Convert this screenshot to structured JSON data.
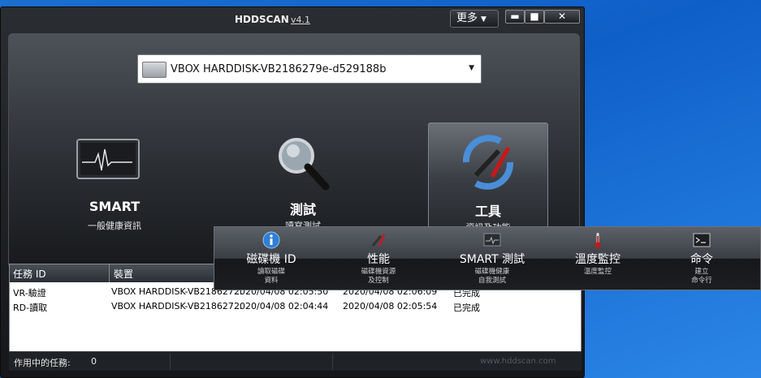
{
  "window": {
    "title": "HDDSCAN",
    "version": "v4.1",
    "more_label": "更多",
    "min_label": "▬",
    "max_label": "■",
    "close_label": "✕"
  },
  "drive": {
    "selected": "VBOX HARDDISK-VB2186279e-d529188b"
  },
  "tiles": [
    {
      "label": "SMART",
      "sub": "一般健康資訊",
      "icon": "monitor-icon"
    },
    {
      "label": "測試",
      "sub": "讀寫測試",
      "icon": "magnifier-icon"
    },
    {
      "label": "工具",
      "sub": "資訊及功能",
      "icon": "tools-icon"
    }
  ],
  "tools_menu": [
    {
      "label": "磁碟機 ID",
      "sub1": "讀取磁碟",
      "sub2": "資料",
      "icon": "info-icon"
    },
    {
      "label": "性能",
      "sub1": "磁碟機資源",
      "sub2": "及控制",
      "icon": "hammer-icon"
    },
    {
      "label": "SMART 測試",
      "sub1": "磁碟機健康",
      "sub2": "自我測試",
      "icon": "pulse-icon"
    },
    {
      "label": "溫度監控",
      "sub1": "溫度監控",
      "sub2": "",
      "icon": "thermometer-icon"
    },
    {
      "label": "命令",
      "sub1": "建立",
      "sub2": "命令行",
      "icon": "terminal-icon"
    }
  ],
  "jobs": {
    "headers": [
      "任務 ID",
      "裝置"
    ],
    "rows": [
      {
        "id": "VR-驗證",
        "device": "VBOX HARDDISK-VB218627...",
        "start": "2020/04/08 02:05:50",
        "end": "2020/04/08 02:06:09",
        "status": "已完成"
      },
      {
        "id": "RD-讀取",
        "device": "VBOX HARDDISK-VB218627...",
        "start": "2020/04/08 02:04:44",
        "end": "2020/04/08 02:05:54",
        "status": "已完成"
      }
    ]
  },
  "status": {
    "active_label": "作用中的任務:",
    "active_count": "0",
    "url": "www.hddscan.com"
  },
  "colors": {
    "desktop": "#1565c8",
    "window_bg": "#1f2226",
    "accent_blue": "#2a7ad8"
  }
}
